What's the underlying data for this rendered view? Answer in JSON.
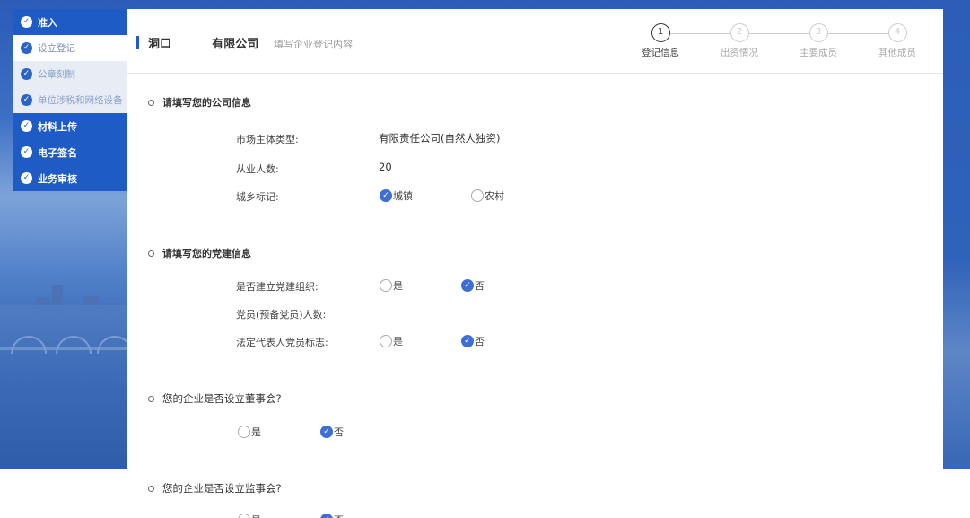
{
  "sidebar": {
    "items": [
      {
        "label": "准入",
        "type": "main"
      },
      {
        "label": "设立登记",
        "type": "sub-active"
      },
      {
        "label": "公章刻制",
        "type": "sub"
      },
      {
        "label": "单位涉税和网络设备",
        "type": "sub"
      },
      {
        "label": "材料上传",
        "type": "main"
      },
      {
        "label": "电子签名",
        "type": "main"
      },
      {
        "label": "业务审核",
        "type": "main"
      }
    ]
  },
  "header": {
    "company": "洞口          有限公司",
    "subtitle": "填写企业登记内容",
    "steps": [
      {
        "num": "1",
        "label": "登记信息",
        "active": true
      },
      {
        "num": "2",
        "label": "出资情况",
        "active": false
      },
      {
        "num": "3",
        "label": "主要成员",
        "active": false
      },
      {
        "num": "4",
        "label": "其他成员",
        "active": false
      }
    ]
  },
  "company_info": {
    "title": "请填写您的公司信息",
    "market_type_label": "市场主体类型:",
    "market_type_value": "有限责任公司(自然人独资)",
    "employees_label": "从业人数:",
    "employees_value": "20",
    "urban_rural_label": "城乡标记:",
    "urban_option": "城镇",
    "rural_option": "农村",
    "urban_rural_selected": "城镇"
  },
  "party_info": {
    "title": "请填写您的党建信息",
    "org_label": "是否建立党建组织:",
    "members_label": "党员(预备党员)人数:",
    "legal_rep_label": "法定代表人党员标志:",
    "yes": "是",
    "no": "否",
    "org_selected": "否",
    "legal_rep_selected": "否"
  },
  "board": {
    "question": "您的企业是否设立董事会?",
    "yes": "是",
    "no": "否",
    "selected": "否"
  },
  "supervisory": {
    "question": "您的企业是否设立监事会?",
    "yes": "是",
    "no": "否",
    "selected": "否"
  },
  "colors": {
    "primary": "#1f5bc4",
    "radio_checked": "#3d6fd6"
  },
  "icons": {
    "check": "check-circle-icon"
  }
}
